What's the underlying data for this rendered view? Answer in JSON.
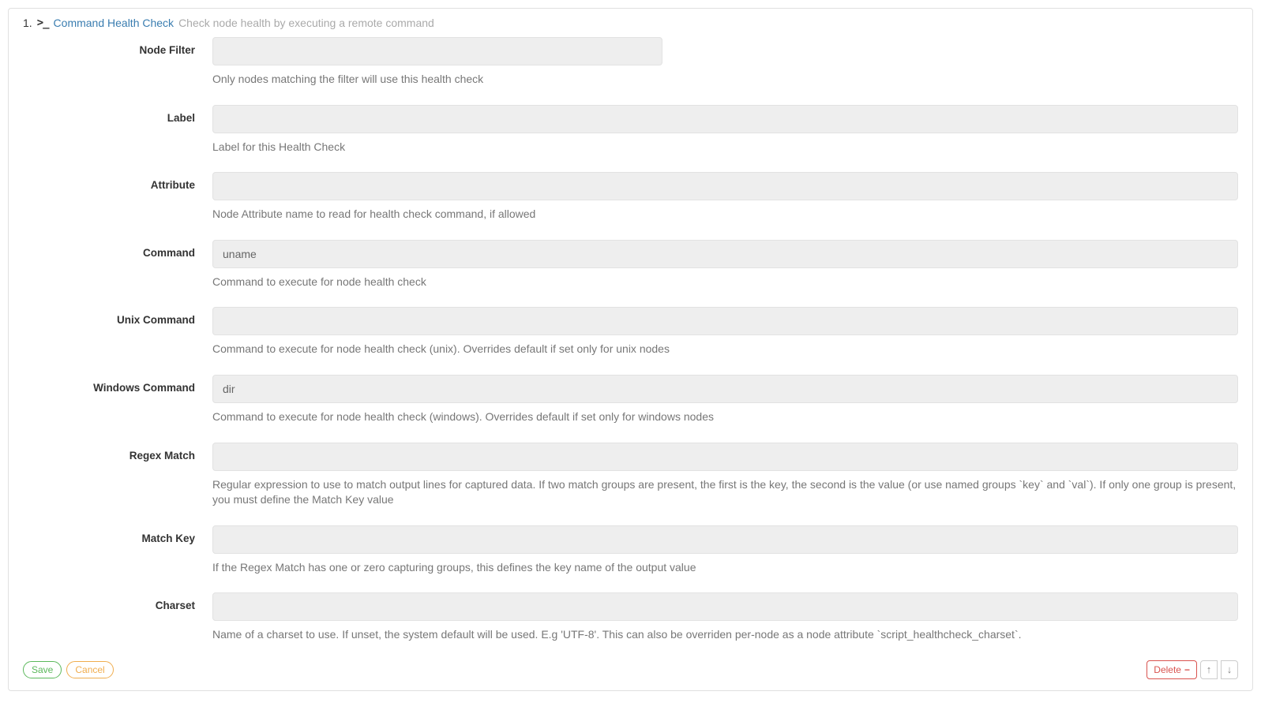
{
  "header": {
    "number": "1.",
    "title": "Command Health Check",
    "description": "Check node health by executing a remote command"
  },
  "fields": {
    "nodeFilter": {
      "label": "Node Filter",
      "value": "",
      "help": "Only nodes matching the filter will use this health check"
    },
    "label": {
      "label": "Label",
      "value": "",
      "help": "Label for this Health Check"
    },
    "attribute": {
      "label": "Attribute",
      "value": "",
      "help": "Node Attribute name to read for health check command, if allowed"
    },
    "command": {
      "label": "Command",
      "value": "uname",
      "help": "Command to execute for node health check"
    },
    "unixCommand": {
      "label": "Unix Command",
      "value": "",
      "help": "Command to execute for node health check (unix). Overrides default if set only for unix nodes"
    },
    "windowsCommand": {
      "label": "Windows Command",
      "value": "dir",
      "help": "Command to execute for node health check (windows). Overrides default if set only for windows nodes"
    },
    "regexMatch": {
      "label": "Regex Match",
      "value": "",
      "help": "Regular expression to use to match output lines for captured data. If two match groups are present, the first is the key, the second is the value (or use named groups `key` and `val`). If only one group is present, you must define the Match Key value"
    },
    "matchKey": {
      "label": "Match Key",
      "value": "",
      "help": "If the Regex Match has one or zero capturing groups, this defines the key name of the output value"
    },
    "charset": {
      "label": "Charset",
      "value": "",
      "help": "Name of a charset to use. If unset, the system default will be used. E.g 'UTF-8'. This can also be overriden per-node as a node attribute `script_healthcheck_charset`."
    }
  },
  "footer": {
    "save": "Save",
    "cancel": "Cancel",
    "delete": "Delete"
  }
}
